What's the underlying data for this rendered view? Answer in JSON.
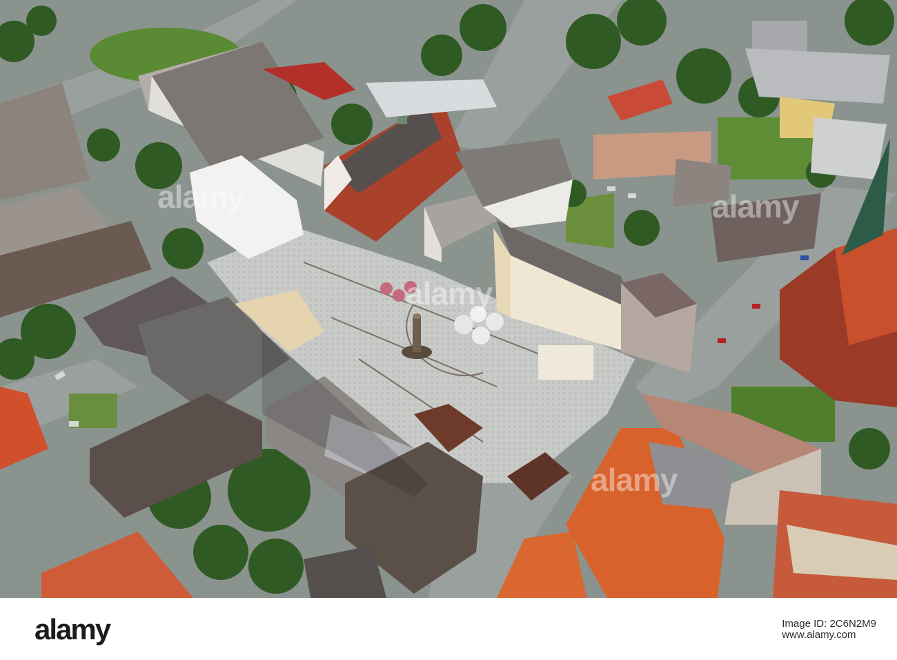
{
  "photo": {
    "subject": "aerial-town-market-square",
    "watermark_text": "alamy"
  },
  "footer": {
    "brand": "alamy",
    "image_id_line": "Image ID: 2C6N2M9",
    "site_line": "www.alamy.com"
  },
  "colors": {
    "roof_red": "#d2602e",
    "brick": "#a9412b",
    "pavement": "#c4c6c4",
    "tree": "#2f5a24",
    "grass": "#5b8a34"
  }
}
